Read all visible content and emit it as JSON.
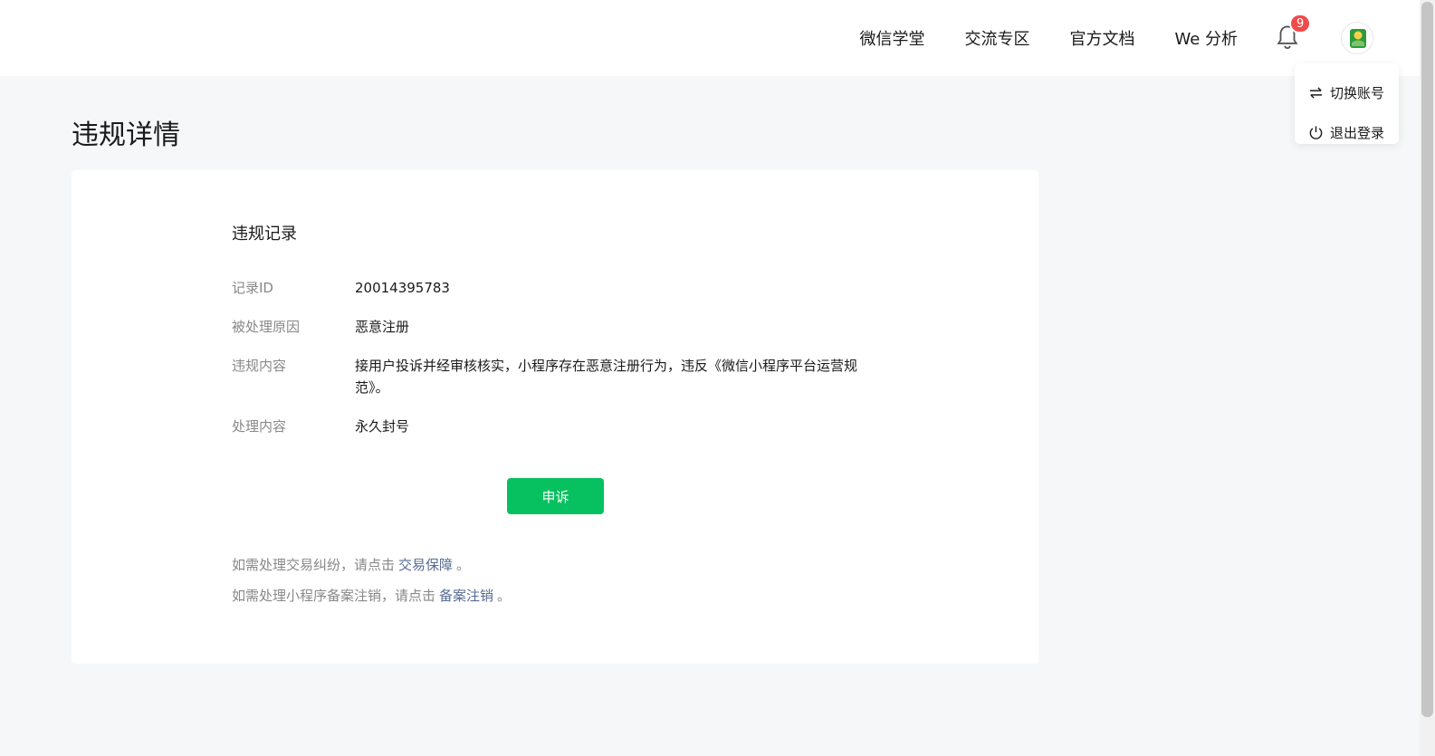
{
  "nav": {
    "items": [
      "微信学堂",
      "交流专区",
      "官方文档",
      "We 分析"
    ],
    "notification_count": "9"
  },
  "account_menu": {
    "switch_account": "切换账号",
    "logout": "退出登录"
  },
  "page": {
    "title": "违规详情"
  },
  "record": {
    "section_title": "违规记录",
    "rows": [
      {
        "label": "记录ID",
        "value": "20014395783"
      },
      {
        "label": "被处理原因",
        "value": "恶意注册"
      },
      {
        "label": "违规内容",
        "value": "接用户投诉并经审核核实，小程序存在恶意注册行为，违反《微信小程序平台运营规范》。"
      },
      {
        "label": "处理内容",
        "value": "永久封号"
      }
    ],
    "appeal_button": "申诉"
  },
  "notes": {
    "trade_prefix": "如需处理交易纠纷，请点击",
    "trade_link": "交易保障",
    "trade_suffix": "。",
    "filing_prefix": "如需处理小程序备案注销，请点击",
    "filing_link": "备案注销",
    "filing_suffix": "。"
  },
  "colors": {
    "primary_green": "#07c160",
    "link_blue": "#576b95",
    "badge_red": "#f04b4b"
  }
}
